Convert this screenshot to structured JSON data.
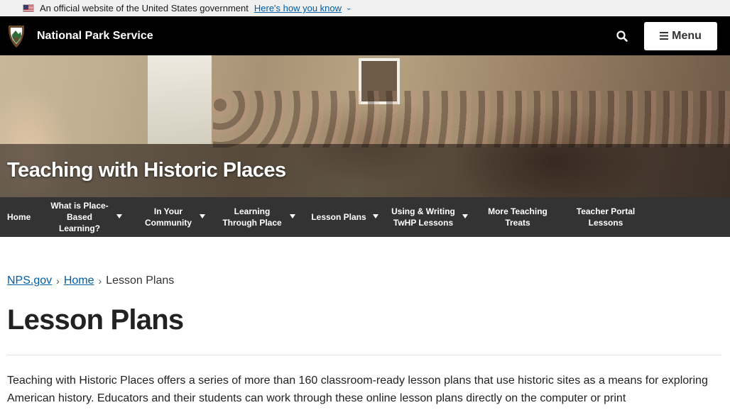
{
  "gov_banner": {
    "text": "An official website of the United States government",
    "link": "Here's how you know"
  },
  "header": {
    "site_name": "National Park Service",
    "menu_label": "Menu"
  },
  "hero": {
    "title": "Teaching with Historic Places"
  },
  "section_nav": {
    "items": [
      {
        "label": "Home"
      },
      {
        "label": "What is Place-Based Learning?"
      },
      {
        "label": "In Your Community"
      },
      {
        "label": "Learning Through Place"
      },
      {
        "label": "Lesson Plans"
      },
      {
        "label": "Using & Writing TwHP Lessons"
      },
      {
        "label": "More Teaching Treats"
      },
      {
        "label": "Teacher Portal Lessons"
      }
    ]
  },
  "breadcrumb": {
    "items": [
      "NPS.gov",
      "Home",
      "Lesson Plans"
    ]
  },
  "page": {
    "title": "Lesson Plans",
    "intro": "Teaching with Historic Places offers a series of more than 160 classroom-ready lesson plans that use historic sites as a means for exploring American history. Educators and their students can work through these online lesson plans directly on the computer or print"
  },
  "colors": {
    "link": "#005ea2",
    "header_bg": "#000000",
    "nav_bg": "#333333"
  }
}
